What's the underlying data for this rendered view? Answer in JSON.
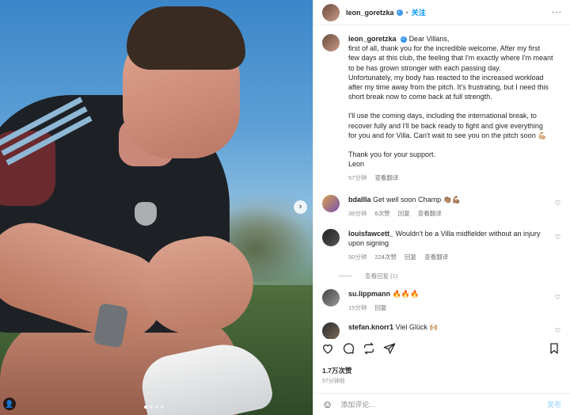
{
  "post": {
    "author": "leon_goretzka",
    "verified_icon": "verified-badge-icon",
    "separator": "•",
    "follow_label": "关注",
    "more_label": "···",
    "caption": {
      "lines": [
        "Dear Villans,",
        "first of all, thank you for the incredible welcome. After my first",
        "few days at this club, the feeling that I'm exactly where I'm meant",
        "to be has grown stronger with each passing day.",
        "Unfortunately, my body has reacted to the increased workload",
        "after my time away from the pitch. It's frustrating, but I need this",
        "short break now to come back at full strength."
      ],
      "lines2": [
        "I'll use the coming days, including the international break, to",
        "recover fully and I'll be back ready to fight and give everything",
        "for you and for Villa. Can't wait to see you on the pitch soon 💪🏼"
      ],
      "lines3": [
        "Thank you for your support.",
        "Leon"
      ],
      "time": "57分钟",
      "translate": "查看翻译"
    },
    "comments": [
      {
        "user": "bdallla",
        "text": "Get well soon Champ 👏🏽💪🏽",
        "time": "38分钟",
        "likes": "6次赞",
        "reply": "回复",
        "translate": "查看翻译"
      },
      {
        "user": "louisfawcett_",
        "text": "Wouldn't be a Villa midfielder without an injury upon signing",
        "time": "50分钟",
        "likes": "224次赞",
        "reply": "回复",
        "translate": "查看翻译"
      },
      {
        "user": "su.lippmann",
        "text": "🔥🔥🔥",
        "time": "15分钟",
        "reply": "回复"
      },
      {
        "user": "stefan.knorr1",
        "text": "Viel Glück 🙌🏼"
      }
    ],
    "view_replies": "查看回复 (1)",
    "likes_total": "1.7万次赞",
    "posted_time": "57分钟前",
    "add_comment_placeholder": "添加评论...",
    "post_label": "发布"
  },
  "media": {
    "next_label": "›",
    "user_tag_label": "👤",
    "slide_count": 4,
    "active_slide": 1
  },
  "colors": {
    "accent": "#0095f6",
    "verified": "#3897f0",
    "muted": "#8e8e8e",
    "text": "#262626"
  }
}
